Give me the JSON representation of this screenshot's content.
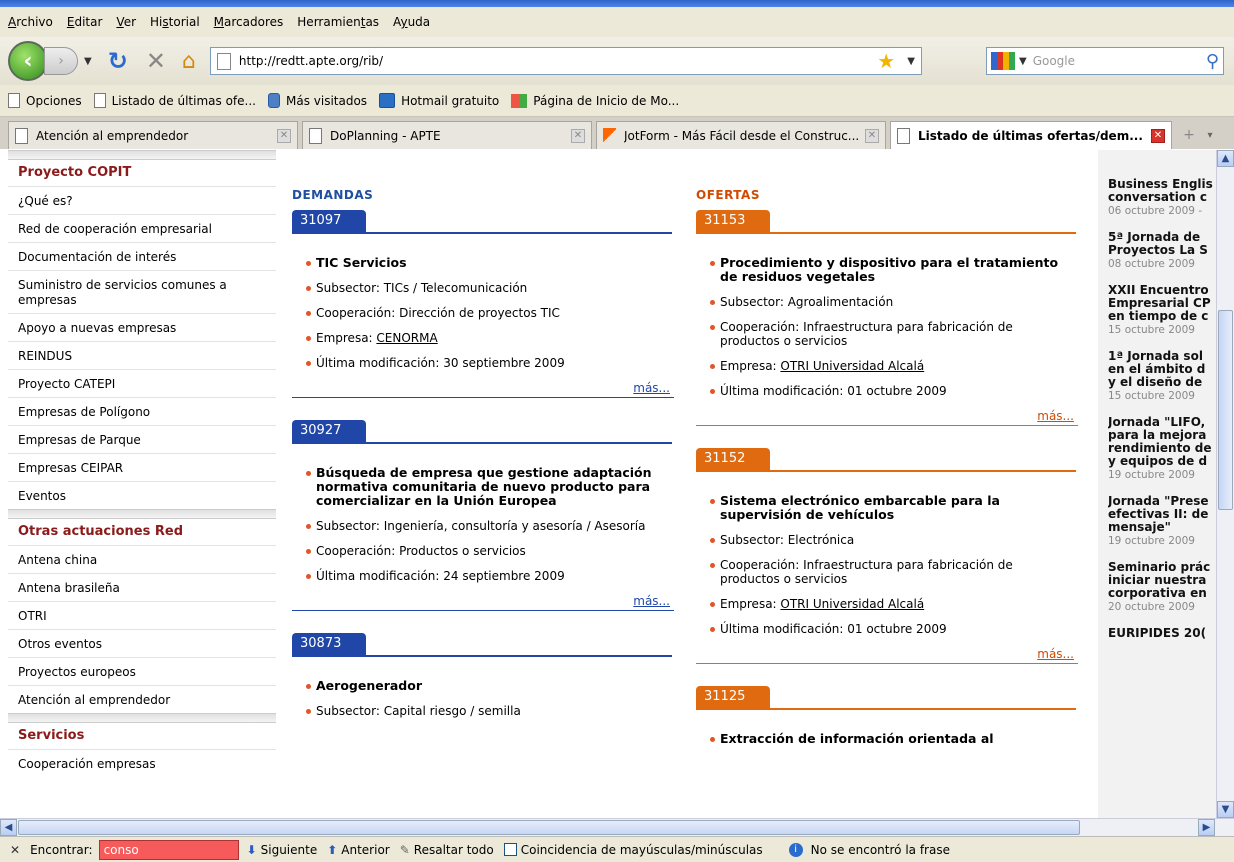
{
  "menu": [
    {
      "text": "Archivo",
      "accel": "A"
    },
    {
      "text": "Editar",
      "accel": "E"
    },
    {
      "text": "Ver",
      "accel": "V"
    },
    {
      "text": "Historial",
      "accel": "s"
    },
    {
      "text": "Marcadores",
      "accel": "M"
    },
    {
      "text": "Herramientas",
      "accel": "t"
    },
    {
      "text": "Ayuda",
      "accel": "y"
    }
  ],
  "navbar": {
    "url": "http://redtt.apte.org/rib/",
    "search_placeholder": "Google"
  },
  "bookmarks": [
    {
      "label": "Opciones",
      "icon": "page-icon"
    },
    {
      "label": "Listado de últimas ofe...",
      "icon": "page-icon"
    },
    {
      "label": "Más visitados",
      "icon": "most-visited-icon"
    },
    {
      "label": "Hotmail gratuito",
      "icon": "msn-icon"
    },
    {
      "label": "Página de Inicio de Mo...",
      "icon": "windows-icon"
    }
  ],
  "tabs": [
    {
      "label": "Atención al emprendedor",
      "active": false
    },
    {
      "label": "DoPlanning - APTE",
      "active": false
    },
    {
      "label": "JotForm - Más Fácil desde el Construc...",
      "active": false
    },
    {
      "label": "Listado de últimas ofertas/dem...",
      "active": true
    }
  ],
  "sidebar": {
    "sections": [
      {
        "heading": "Proyecto COPIT",
        "items": [
          "¿Qué es?",
          "Red de cooperación empresarial",
          "Documentación de interés",
          "Suministro de servicios comunes a empresas",
          "Apoyo a nuevas empresas",
          "REINDUS",
          "Proyecto CATEPI",
          "Empresas de Polígono",
          "Empresas de Parque",
          "Empresas CEIPAR",
          "Eventos"
        ]
      },
      {
        "heading": "Otras actuaciones Red",
        "items": [
          "Antena china",
          "Antena brasileña",
          "OTRI",
          "Otros eventos",
          "Proyectos europeos",
          "Atención al emprendedor"
        ]
      },
      {
        "heading": "Servicios",
        "items": [
          "Cooperación empresas"
        ]
      }
    ]
  },
  "demandas": {
    "title": "DEMANDAS",
    "cards": [
      {
        "id": "31097",
        "title": "TIC Servicios",
        "subsector": "Subsector: TICs / Telecomunicación",
        "cooperacion": "Cooperación: Dirección de proyectos TIC",
        "empresa_label": "Empresa: ",
        "empresa": "CENORMA",
        "modificacion": "Última modificación: 30 septiembre 2009",
        "mas": "más..."
      },
      {
        "id": "30927",
        "title": "Búsqueda de empresa que gestione adaptación normativa comunitaria de nuevo producto para comercializar en la Unión Europea",
        "subsector": "Subsector: Ingeniería, consultoría y asesoría / Asesoría",
        "cooperacion": "Cooperación: Productos o servicios",
        "modificacion": "Última modificación: 24 septiembre 2009",
        "mas": "más..."
      },
      {
        "id": "30873",
        "title": "Aerogenerador",
        "subsector": "Subsector: Capital riesgo / semilla"
      }
    ]
  },
  "ofertas": {
    "title": "OFERTAS",
    "cards": [
      {
        "id": "31153",
        "title": "Procedimiento y dispositivo para el tratamiento de residuos vegetales",
        "subsector": "Subsector: Agroalimentación",
        "cooperacion": "Cooperación: Infraestructura para fabricación de productos o servicios",
        "empresa_label": "Empresa: ",
        "empresa": "OTRI Universidad Alcalá",
        "modificacion": "Última modificación: 01 octubre 2009",
        "mas": "más..."
      },
      {
        "id": "31152",
        "title": "Sistema electrónico embarcable para la supervisión de vehículos",
        "subsector": "Subsector: Electrónica",
        "cooperacion": "Cooperación: Infraestructura para fabricación de productos o servicios",
        "empresa_label": "Empresa: ",
        "empresa": "OTRI Universidad Alcalá",
        "modificacion": "Última modificación: 01 octubre 2009",
        "mas": "más..."
      },
      {
        "id": "31125",
        "title": "Extracción de información orientada al"
      }
    ]
  },
  "news": [
    {
      "title": [
        "Business Englis",
        "conversation c"
      ],
      "date": "06 octubre 2009 -"
    },
    {
      "title": [
        "5ª Jornada de",
        "Proyectos La S"
      ],
      "date": "08 octubre 2009"
    },
    {
      "title": [
        "XXII Encuentro",
        "Empresarial CP",
        "en tiempo de c"
      ],
      "date": "15 octubre 2009"
    },
    {
      "title": [
        "1ª Jornada sol",
        "en el ámbito d",
        "y el diseño de"
      ],
      "date": "15 octubre 2009"
    },
    {
      "title": [
        "Jornada \"LIFO,",
        "para la mejora",
        "rendimiento de",
        "y equipos de d"
      ],
      "date": "19 octubre 2009"
    },
    {
      "title": [
        "Jornada \"Prese",
        "efectivas II: de",
        "mensaje\""
      ],
      "date": "19 octubre 2009"
    },
    {
      "title": [
        "Seminario prác",
        "iniciar nuestra",
        "corporativa en"
      ],
      "date": "20 octubre 2009"
    },
    {
      "title": [
        "EURIPIDES 20("
      ],
      "date": ""
    }
  ],
  "findbar": {
    "label": "Encontrar:",
    "value": "conso",
    "next": "Siguiente",
    "prev": "Anterior",
    "highlight": "Resaltar todo",
    "matchcase": "Coincidencia de mayúsculas/minúsculas",
    "status": "No se encontró la frase"
  }
}
